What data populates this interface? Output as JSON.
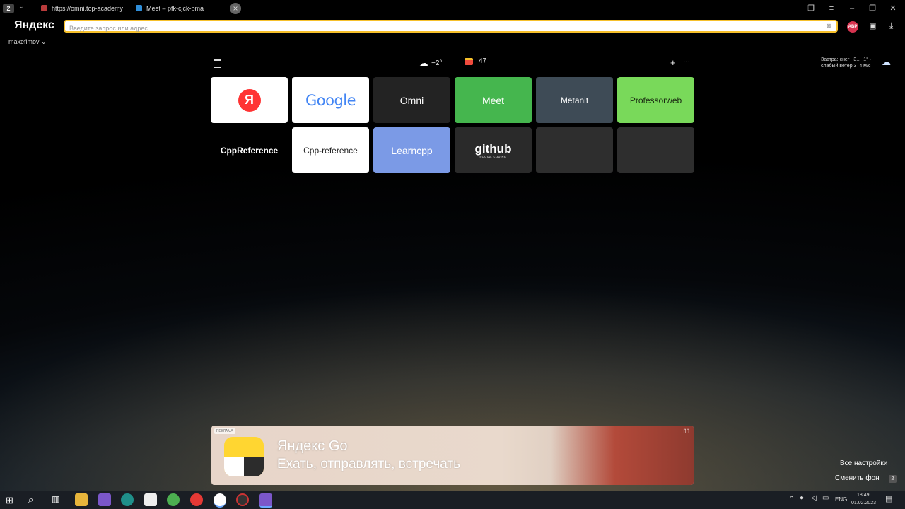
{
  "tabs": [
    {
      "count": "2",
      "label": "https://omni.top-academy",
      "fav_color": "#b93b3b"
    },
    {
      "label": "Meet – pfk-cjck-bma",
      "fav_color": "#2f8ed9"
    }
  ],
  "window_icons": [
    "bookmarks-icon",
    "menu-icon",
    "minimize-icon",
    "restore-icon",
    "close-icon"
  ],
  "header": {
    "logo": "Яндекс",
    "search_placeholder": "Введите запрос или адрес",
    "abp": "ABP",
    "user": "maxefimov ⌄"
  },
  "widgets": {
    "weather_temp": "−2°",
    "mail_count": "47",
    "add": "+",
    "more": "···",
    "forecast": "Завтра: снег −3...−1° · слабый ветер 3–4 м/с"
  },
  "tiles": [
    {
      "label": "Я",
      "bg": "#ffffff",
      "color": "#ffffff",
      "kind": "yandex"
    },
    {
      "label": "Google",
      "bg": "#ffffff",
      "color": "#4285f4",
      "kind": "google"
    },
    {
      "label": "Omni",
      "bg": "#232323",
      "color": "#ffffff"
    },
    {
      "label": "Meet",
      "bg": "#45b64e",
      "color": "#ffffff"
    },
    {
      "label": "Metanit",
      "bg": "#3e4b56",
      "color": "#ffffff"
    },
    {
      "label": "Professorweb",
      "bg": "#79d95a",
      "color": "#1a2a12"
    },
    {
      "label": "CppReference",
      "bg": "transparent",
      "color": "#ffffff"
    },
    {
      "label": "Cpp-reference",
      "bg": "#ffffff",
      "color": "#222222"
    },
    {
      "label": "Learncpp",
      "bg": "#7b9ae6",
      "color": "#ffffff"
    },
    {
      "label": "github",
      "sub": "SOCIAL CODING",
      "bg": "#2a2a2a",
      "color": "#ffffff"
    },
    {
      "label": "",
      "bg": "rgba(255,255,255,0.18)",
      "color": "#ffffff"
    },
    {
      "label": "",
      "bg": "rgba(255,255,255,0.18)",
      "color": "#ffffff"
    }
  ],
  "ad": {
    "badge": "РЕКЛАМА",
    "title": "Яндекс Go",
    "subtitle": "Ехать, отправлять, встречать"
  },
  "footer": {
    "all_settings": "Все настройки",
    "change_bg": "Сменить фон",
    "badge": "2"
  },
  "taskbar": {
    "lang": "ENG",
    "time": "18:49",
    "date": "01.02.2023"
  }
}
